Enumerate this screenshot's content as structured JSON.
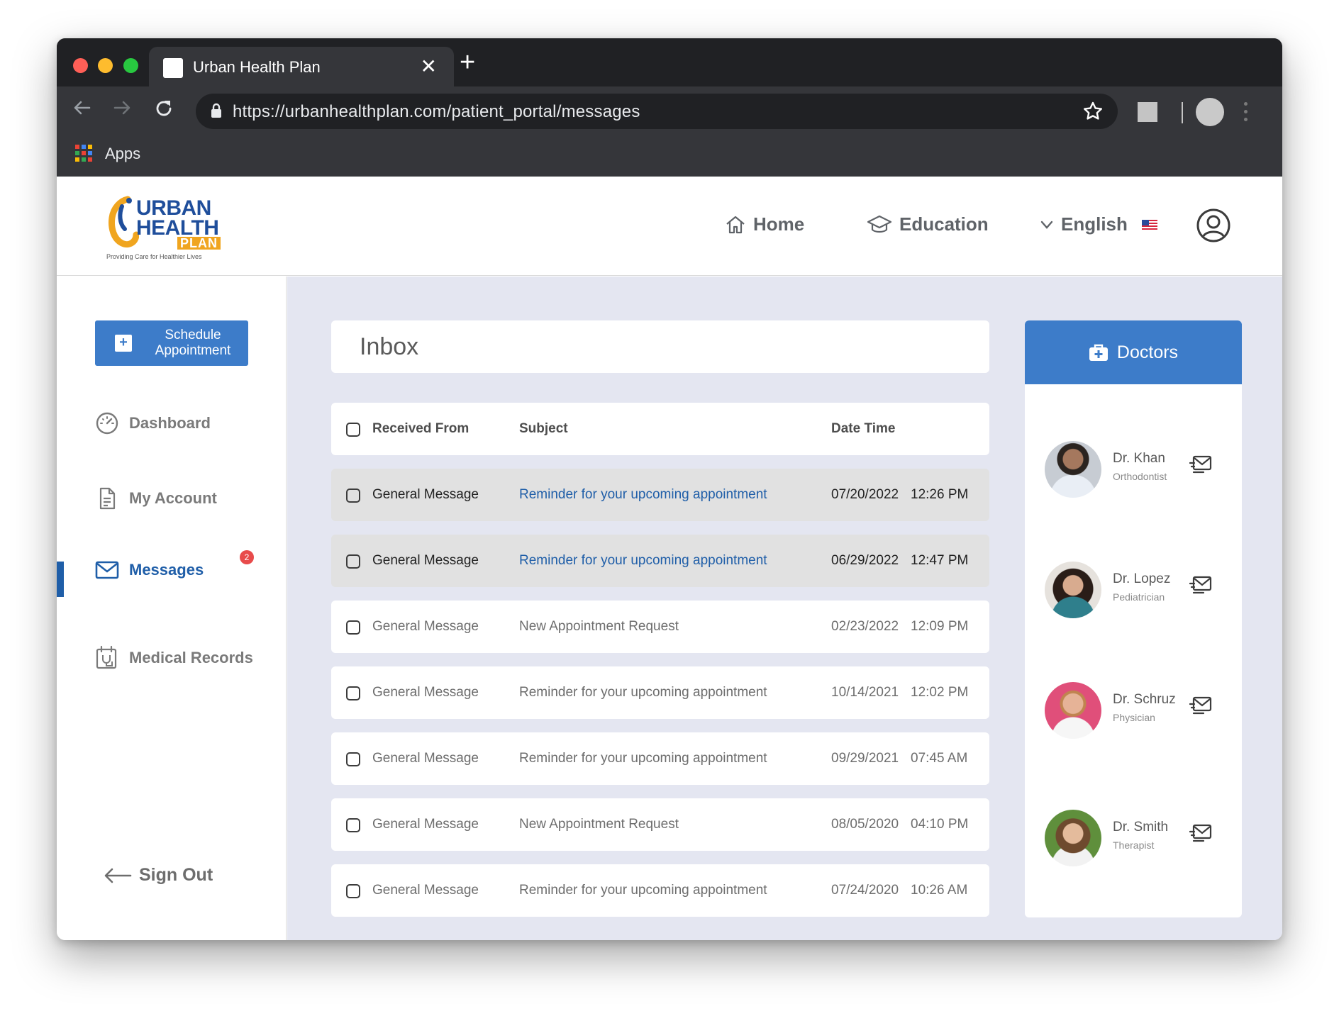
{
  "browser": {
    "tab_title": "Urban Health Plan",
    "tab_close": "✕",
    "new_tab": "+",
    "url": "https://urbanhealthplan.com/patient_portal/messages",
    "bookmarks_label": "Apps"
  },
  "header": {
    "logo": {
      "line1": "URBAN",
      "line2": "HEALTH",
      "line3": "PLAN",
      "tagline": "Providing Care for Healthier Lives"
    },
    "nav": {
      "home": "Home",
      "education": "Education",
      "language": "English"
    }
  },
  "sidebar": {
    "schedule_line1": "Schedule",
    "schedule_line2": "Appointment",
    "items": {
      "dashboard": "Dashboard",
      "account": "My Account",
      "messages": "Messages",
      "messages_badge": "2",
      "records": "Medical Records"
    },
    "sign_out": "Sign Out"
  },
  "inbox": {
    "title": "Inbox",
    "columns": {
      "from": "Received From",
      "subject": "Subject",
      "datetime": "Date Time"
    },
    "rows": [
      {
        "from": "General Message",
        "subject": "Reminder for your upcoming appointment",
        "date": "07/20/2022",
        "time": "12:26 PM",
        "unread": true
      },
      {
        "from": "General Message",
        "subject": "Reminder for your upcoming appointment",
        "date": "06/29/2022",
        "time": "12:47 PM",
        "unread": true
      },
      {
        "from": "General Message",
        "subject": "New Appointment Request",
        "date": "02/23/2022",
        "time": "12:09 PM",
        "unread": false
      },
      {
        "from": "General Message",
        "subject": "Reminder for your upcoming appointment",
        "date": "10/14/2021",
        "time": "12:02 PM",
        "unread": false
      },
      {
        "from": "General Message",
        "subject": "Reminder for your upcoming appointment",
        "date": "09/29/2021",
        "time": "07:45 AM",
        "unread": false
      },
      {
        "from": "General Message",
        "subject": "New Appointment Request",
        "date": "08/05/2020",
        "time": "04:10 PM",
        "unread": false
      },
      {
        "from": "General Message",
        "subject": "Reminder for your upcoming appointment",
        "date": "07/24/2020",
        "time": "10:26 AM",
        "unread": false
      }
    ]
  },
  "doctors": {
    "title": "Doctors",
    "list": [
      {
        "name": "Dr. Khan",
        "role": "Orthodontist"
      },
      {
        "name": "Dr. Lopez",
        "role": "Pediatrician"
      },
      {
        "name": "Dr. Schruz",
        "role": "Physician"
      },
      {
        "name": "Dr. Smith",
        "role": "Therapist"
      }
    ]
  },
  "colors": {
    "accent": "#3d7cc9",
    "active": "#1f5ea8",
    "main_bg": "#e4e6f1",
    "badge": "#e84b4b",
    "chrome_dark": "#202124",
    "chrome": "#35363a"
  }
}
